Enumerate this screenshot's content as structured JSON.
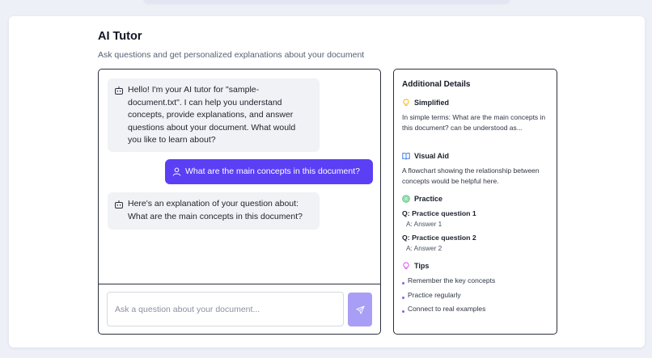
{
  "header": {
    "title": "AI Tutor",
    "subtitle": "Ask questions and get personalized explanations about your document"
  },
  "chat": {
    "messages": [
      {
        "role": "assistant",
        "text": "Hello! I'm your AI tutor for \"sample-document.txt\". I can help you understand concepts, provide explanations, and answer questions about your document. What would you like to learn about?"
      },
      {
        "role": "user",
        "text": "What are the main concepts in this document?"
      },
      {
        "role": "assistant",
        "text": "Here's an explanation of your question about: What are the main concepts in this document?"
      }
    ],
    "input_placeholder": "Ask a question about your document...",
    "send_icon": "send-icon"
  },
  "details": {
    "title": "Additional Details",
    "simplified": {
      "heading": "Simplified",
      "icon": "lightbulb-icon",
      "text": "In simple terms: What are the main concepts in this document? can be understood as..."
    },
    "visual_aid": {
      "heading": "Visual Aid",
      "icon": "book-icon",
      "text": "A flowchart showing the relationship between concepts would be helpful here."
    },
    "practice": {
      "heading": "Practice",
      "icon": "target-icon",
      "items": [
        {
          "q": "Q: Practice question 1",
          "a": "A: Answer 1"
        },
        {
          "q": "Q: Practice question 2",
          "a": "A: Answer 2"
        }
      ]
    },
    "tips": {
      "heading": "Tips",
      "icon": "lightbulb-icon",
      "items": [
        "Remember the key concepts",
        "Practice regularly",
        "Connect to real examples"
      ]
    }
  },
  "colors": {
    "accent": "#5b3ff5",
    "send_button": "#a99ef5",
    "simplified_icon": "#f5b301",
    "visual_aid_icon": "#2f6fe0",
    "practice_icon": "#22b35e",
    "tips_icon": "#d946ef",
    "tip_bullet": "#8b5cf6"
  }
}
